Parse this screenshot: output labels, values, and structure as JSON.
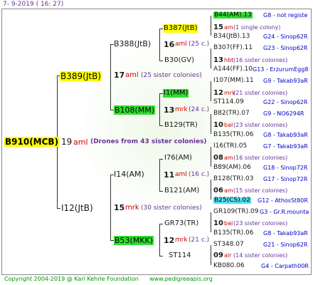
{
  "header": {
    "date": "7-  9-2019  ( 16: 27)"
  },
  "root": {
    "code": "B910(MCB)",
    "year": "19",
    "type": "aml",
    "note": "(Drones from 43 sister colonies)"
  },
  "gen1": [
    {
      "code": "B389(JtB)",
      "year": "17",
      "type": "aml",
      "note": "(25 sister colonies)"
    },
    {
      "code": "I12(JtB)",
      "year": "15",
      "type": "mrk",
      "note": "(30 sister colonies)"
    }
  ],
  "gen2": [
    {
      "code": "B388(JtB)",
      "year": "16",
      "type": "aml",
      "note": "(25 c.)"
    },
    {
      "code": "B108(MM)",
      "year": "13",
      "type": "mrk",
      "note": "(24 c.)"
    },
    {
      "code": "I14(AM)",
      "year": "11",
      "type": "aml",
      "note": "(16 c.)"
    },
    {
      "code": "B53(MKK)",
      "year": "12",
      "type": "mrk",
      "note": "(21 c.)"
    }
  ],
  "gen3": [
    {
      "code": "B387(JtB)",
      "year": "15",
      "type": "am",
      "note": "(1 single colony)"
    },
    {
      "code": "B30(GV)",
      "year": "13",
      "type": "hbt",
      "note": "(16 sister colonies)"
    },
    {
      "code": "I1(MM)",
      "year": "12",
      "type": "mrk",
      "note": "(21 sister colonies)"
    },
    {
      "code": "B129(TR)",
      "year": "10",
      "type": "bal",
      "note": "(23 sister colonies)"
    },
    {
      "code": "I76(AM)",
      "year": "08",
      "type": "am",
      "note": "(16 sister colonies)"
    },
    {
      "code": "B121(AM)",
      "year": "06",
      "type": "am",
      "note": "(15 sister colonies)"
    },
    {
      "code": "GR73(TR)",
      "year": "10",
      "type": "bal",
      "note": "(23 sister colonies)"
    },
    {
      "code": "ST114",
      "year": "09",
      "type": "alr",
      "note": "(14 sister colonies)"
    }
  ],
  "gen4": [
    {
      "code": "B44(AM).13",
      "right": "G8 - not registe"
    },
    {
      "code": "B34(JtB).13",
      "right": "G24 - Sinop62R"
    },
    {
      "code": "B307(FF).11",
      "right": "G23 - Sinop62R"
    },
    {
      "code": "A144(FF).10",
      "right": "G13 - ErzurumEgg8"
    },
    {
      "code": "I107(MM).11",
      "right": "G9 - Takab93aR"
    },
    {
      "code": "ST114.09",
      "right": "G22 - Sinop62R"
    },
    {
      "code": "B82(TR).07",
      "right": "G9 - NO6294R"
    },
    {
      "code": "B135(TR).06",
      "right": "G8 - Takab93aR"
    },
    {
      "code": "I16(TR).05",
      "right": "G7 - Takab93aR"
    },
    {
      "code": "B89(AM).06",
      "right": "G18 - Sinop72R"
    },
    {
      "code": "B128(TR).03",
      "right": "G17 - Sinop72R"
    },
    {
      "code": "B25(CS).02",
      "right": "G12 - AthosSt80R"
    },
    {
      "code": "GR109(TR).09",
      "right": "G3 - Gr.R.mounta"
    },
    {
      "code": "B135(TR).06",
      "right": "G8 - Takab93aR"
    },
    {
      "code": "ST348.07",
      "right": "G21 - Sinop62R"
    },
    {
      "code": "KB080.06",
      "right": "G4 - Carpath00R"
    }
  ],
  "footer": {
    "copyright": "Copyright 2004-2019 @ Karl Kehrle Foundation",
    "url": "www.pedigreeapis.org"
  }
}
